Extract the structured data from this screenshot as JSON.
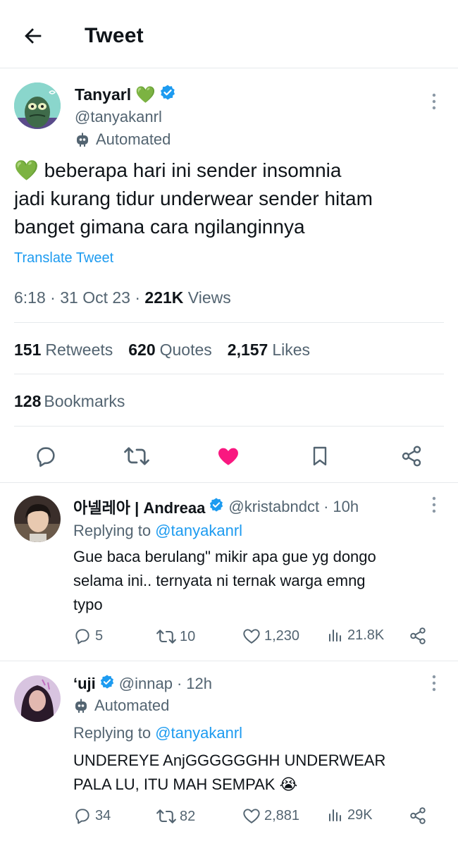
{
  "header": {
    "title": "Tweet"
  },
  "main_tweet": {
    "display_name": "Tanyarl",
    "name_emoji": "💚",
    "handle": "@tanyakanrl",
    "automated_label": "Automated",
    "text_emoji": "💚",
    "text_lines": [
      "beberapa hari ini sender insomnia",
      "jadi kurang tidur underwear sender hitam",
      "banget gimana cara ngilanginnya"
    ],
    "translate_label": "Translate Tweet",
    "time": "6:18",
    "date": "31 Oct 23",
    "views_count": "221K",
    "views_label": "Views",
    "retweets_count": "151",
    "retweets_label": "Retweets",
    "quotes_count": "620",
    "quotes_label": "Quotes",
    "likes_count": "2,157",
    "likes_label": "Likes",
    "bookmarks_count": "128",
    "bookmarks_label": "Bookmarks",
    "liked": true,
    "like_color": "#f91880"
  },
  "replies": [
    {
      "display_name": "아넬레아 | Andreaa",
      "handle": "@kristabndct",
      "time": "10h",
      "automated_label": "",
      "replying_prefix": "Replying to",
      "replying_to": "@tanyakanrl",
      "text_lines": [
        "Gue baca berulang\" mikir apa gue yg dongo",
        "selama ini.. ternyata ni ternak warga emng",
        "typo"
      ],
      "text_emoji": "",
      "replies": "5",
      "retweets": "10",
      "likes": "1,230",
      "views": "21.8K"
    },
    {
      "display_name": "ʻuji",
      "handle": "@innap",
      "time": "12h",
      "automated_label": "Automated",
      "replying_prefix": "Replying to",
      "replying_to": "@tanyakanrl",
      "text_lines": [
        "UNDEREYE AnjGGGGGGHH UNDERWEAR",
        "PALA LU, ITU MAH SEMPAK"
      ],
      "text_emoji": "😭",
      "replies": "34",
      "retweets": "82",
      "likes": "2,881",
      "views": "29K"
    }
  ],
  "colors": {
    "accent": "#1d9bf0",
    "secondary_text": "#536471",
    "like": "#f91880",
    "verified": "#1d9bf0"
  }
}
